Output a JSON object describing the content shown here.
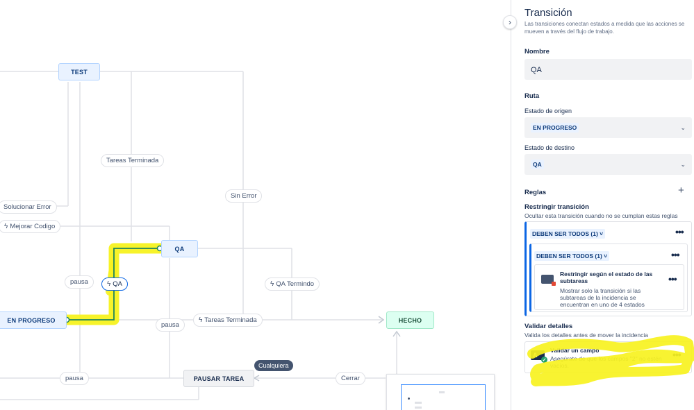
{
  "canvas": {
    "statuses": {
      "test": "TEST",
      "qa": "QA",
      "en_progreso": "EN PROGRESO",
      "hecho": "HECHO",
      "pausar_tarea": "PAUSAR TAREA"
    },
    "transitions": {
      "solucionar_error": "Solucionar Error",
      "mejorar_codigo": "Mejorar Codigo",
      "tareas_terminada_top": "Tareas Terminada",
      "sin_error": "Sin Error",
      "pausa_left": "pausa",
      "qa": "QA",
      "qa_termindo": "QA Termindo",
      "pausa_mid": "pausa",
      "tareas_terminada_bottom": "Tareas Terminada",
      "pausa_bottom": "pausa",
      "cerrar": "Cerrar"
    },
    "tooltip_cualquiera": "Cualquiera"
  },
  "panel": {
    "title": "Transición",
    "description": "Las transiciones conectan estados a medida que las acciones se mueven a través del flujo de trabajo.",
    "nombre_label": "Nombre",
    "nombre_value": "QA",
    "ruta_label": "Ruta",
    "origen_label": "Estado de origen",
    "origen_value": "EN PROGRESO",
    "destino_label": "Estado de destino",
    "destino_value": "QA",
    "reglas_label": "Reglas",
    "restringir_title": "Restringir transición",
    "restringir_desc": "Ocultar esta transición cuando no se cumplan estas reglas",
    "group_outer": "DEBEN SER TODOS (1) ˅",
    "group_inner": "DEBEN SER TODOS (1) ˅",
    "rule_title": "Restringir según el estado de las subtareas",
    "rule_desc": "Mostrar solo la transición si las subtareas de la incidencia se encuentran en uno de 4 estados",
    "validar_title": "Validar detalles",
    "validar_desc": "Valida los detalles antes de mover la incidencia",
    "val_rule_title": "Validar un campo",
    "val_rule_desc": "Asegúrate de que los campos \"2\" no estén vacíos."
  },
  "colors": {
    "highlight": "#f7f21f",
    "accent": "#0c66e4",
    "connector_active": "#1f845a"
  }
}
